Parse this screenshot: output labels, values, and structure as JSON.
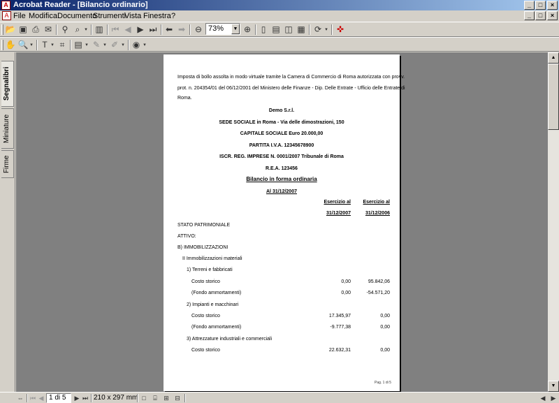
{
  "window": {
    "title": "Acrobat Reader - [Bilancio ordinario]"
  },
  "menu": [
    "File",
    "Modifica",
    "Documento",
    "Strumenti",
    "Vista",
    "Finestra",
    "?"
  ],
  "toolbar": {
    "zoom": "73%"
  },
  "sidebar": {
    "tabs": [
      "Segnalibri",
      "Miniature",
      "Firme"
    ]
  },
  "document": {
    "header_lines": [
      "Imposta di bollo assolta in modo virtuale tramite la Camera di Commercio di Roma autorizzata con provv.",
      "prot. n. 204354/01 del 06/12/2001 del Ministero delle Finanze - Dip. Delle Entrate - Ufficio delle Entrate di",
      "Roma."
    ],
    "company": [
      "Demo S.r.l.",
      "SEDE SOCIALE in Roma - Via delle dimostrazioni, 150",
      "CAPITALE SOCIALE Euro 20.000,00",
      "PARTITA I.V.A. 12345678900",
      "ISCR. REG. IMPRESE N. 0001/2007 Tribunale di Roma",
      "R.E.A. 123456"
    ],
    "doc_title": "Bilancio in forma ordinaria",
    "doc_date": "Al 31/12/2007",
    "col1_label": "Esercizio al",
    "col1_date": "31/12/2007",
    "col2_label": "Esercizio al",
    "col2_date": "31/12/2006",
    "sections": [
      "STATO PATRIMONIALE",
      "ATTIVO:",
      "B) IMMOBILIZZAZIONI",
      "II Immobilizzazioni materiali"
    ],
    "rows": [
      {
        "label": "1) Terreni e fabbricati",
        "v1": "",
        "v2": ""
      },
      {
        "label": "Costo storico",
        "v1": "0,00",
        "v2": "95.842,06"
      },
      {
        "label": "(Fondo ammortamenti)",
        "v1": "0,00",
        "v2": "-54.571,20"
      },
      {
        "label": "2) Impianti e macchinari",
        "v1": "",
        "v2": ""
      },
      {
        "label": "Costo storico",
        "v1": "17.345,97",
        "v2": "0,00"
      },
      {
        "label": "(Fondo ammortamenti)",
        "v1": "-9.777,38",
        "v2": "0,00"
      },
      {
        "label": "3) Attrezzature industriali e commerciali",
        "v1": "",
        "v2": ""
      },
      {
        "label": "Costo storico",
        "v1": "22.632,31",
        "v2": "0,00"
      }
    ],
    "footer": "Pag. 1     di 5"
  },
  "status": {
    "page": "1 di 5",
    "page_size": "210 x 297 mm"
  }
}
